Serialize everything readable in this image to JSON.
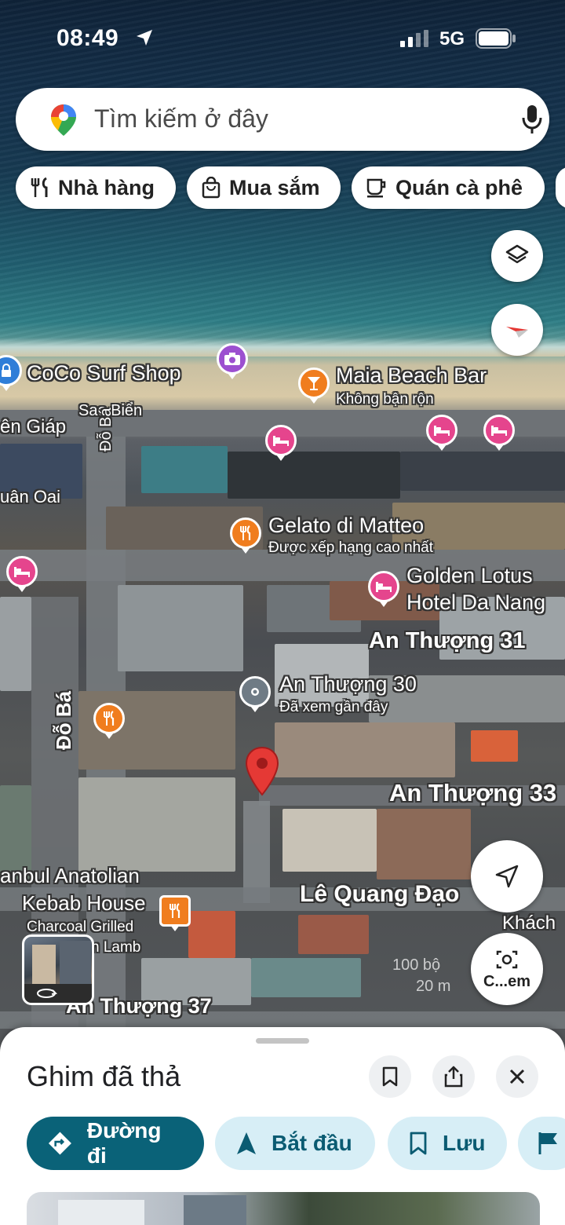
{
  "status_bar": {
    "time": "08:49",
    "network": "5G"
  },
  "search": {
    "placeholder": "Tìm kiếm ở đây"
  },
  "chips": [
    {
      "label": "Nhà hàng",
      "icon": "fork-knife-icon"
    },
    {
      "label": "Mua sắm",
      "icon": "shopping-bag-icon"
    },
    {
      "label": "Quán cà phê",
      "icon": "coffee-cup-icon"
    }
  ],
  "map": {
    "labels": {
      "coco": "CoCo Surf Shop",
      "sao_bien": "Sao Biển",
      "maia": "Maia Beach Bar",
      "maia_sub": "Không bận rộn",
      "ven_giap": "ên Giáp",
      "do_ba_1": "Đỗ Bá",
      "uan_oai": "uân Oai",
      "gelato": "Gelato di Matteo",
      "gelato_sub": "Được xếp hạng cao nhất",
      "golden_lotus_1": "Golden Lotus",
      "golden_lotus_2": "Hotel Da Nang",
      "an_thuong_31": "An Thượng 31",
      "an_thuong_30": "An Thượng 30",
      "an_thuong_30_sub": "Đã xem gần đây",
      "do_ba_2": "Đỗ Bá",
      "an_thuong_33": "An Thượng 33",
      "anbul_1": "anbul Anatolian",
      "anbul_2": "Kebab House",
      "anbul_3": "Charcoal Grilled",
      "anbul_4": "n Lamb",
      "le_quang_dao": "Lê Quang Đạo",
      "khach": "Khách",
      "an_thuong_37": "An Thượng 37",
      "scale_1": "100 bộ",
      "scale_2": "20 m",
      "lens_label": "C...em"
    },
    "colors": {
      "hotel": "#e5458d",
      "food": "#f07d1e",
      "camera": "#9c4fd0",
      "dropped_pin": "#e53935"
    }
  },
  "sheet": {
    "title": "Ghim đã thả",
    "actions": [
      {
        "label": "Đường đi",
        "icon": "directions-icon"
      },
      {
        "label": "Bắt đầu",
        "icon": "navigation-arrow-icon"
      },
      {
        "label": "Lưu",
        "icon": "bookmark-icon"
      }
    ]
  }
}
